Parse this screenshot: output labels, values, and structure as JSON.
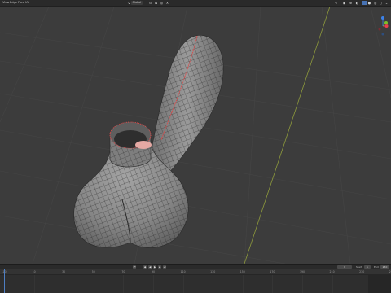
{
  "header": {
    "menus": [
      {
        "label": "View"
      },
      {
        "label": "Edge"
      },
      {
        "label": "Face"
      },
      {
        "label": "UV"
      }
    ],
    "transform_orientation": "Global",
    "icons": [
      "cursor-icon",
      "snap-icon",
      "proportional-icon",
      "overlay-icon",
      "viewport-shading-icon"
    ]
  },
  "gizmo": {
    "axes": [
      "X",
      "Y",
      "Z"
    ],
    "colors": {
      "x": "#e83f4b",
      "y": "#7bbd2a",
      "z": "#3d82e8"
    }
  },
  "timeline": {
    "current_frame": "1",
    "start_label": "Start",
    "start_value": "1",
    "end_label": "End",
    "end_value": "250",
    "ticks": [
      "-10",
      "10",
      "30",
      "50",
      "70",
      "90",
      "110",
      "130",
      "150",
      "170",
      "190",
      "210",
      "230",
      "250"
    ]
  },
  "colors": {
    "seam": "#e04848",
    "mesh_wire": "#1a1a1a",
    "surface": "#8c8c8c",
    "selected_face": "#e5a9a4"
  }
}
